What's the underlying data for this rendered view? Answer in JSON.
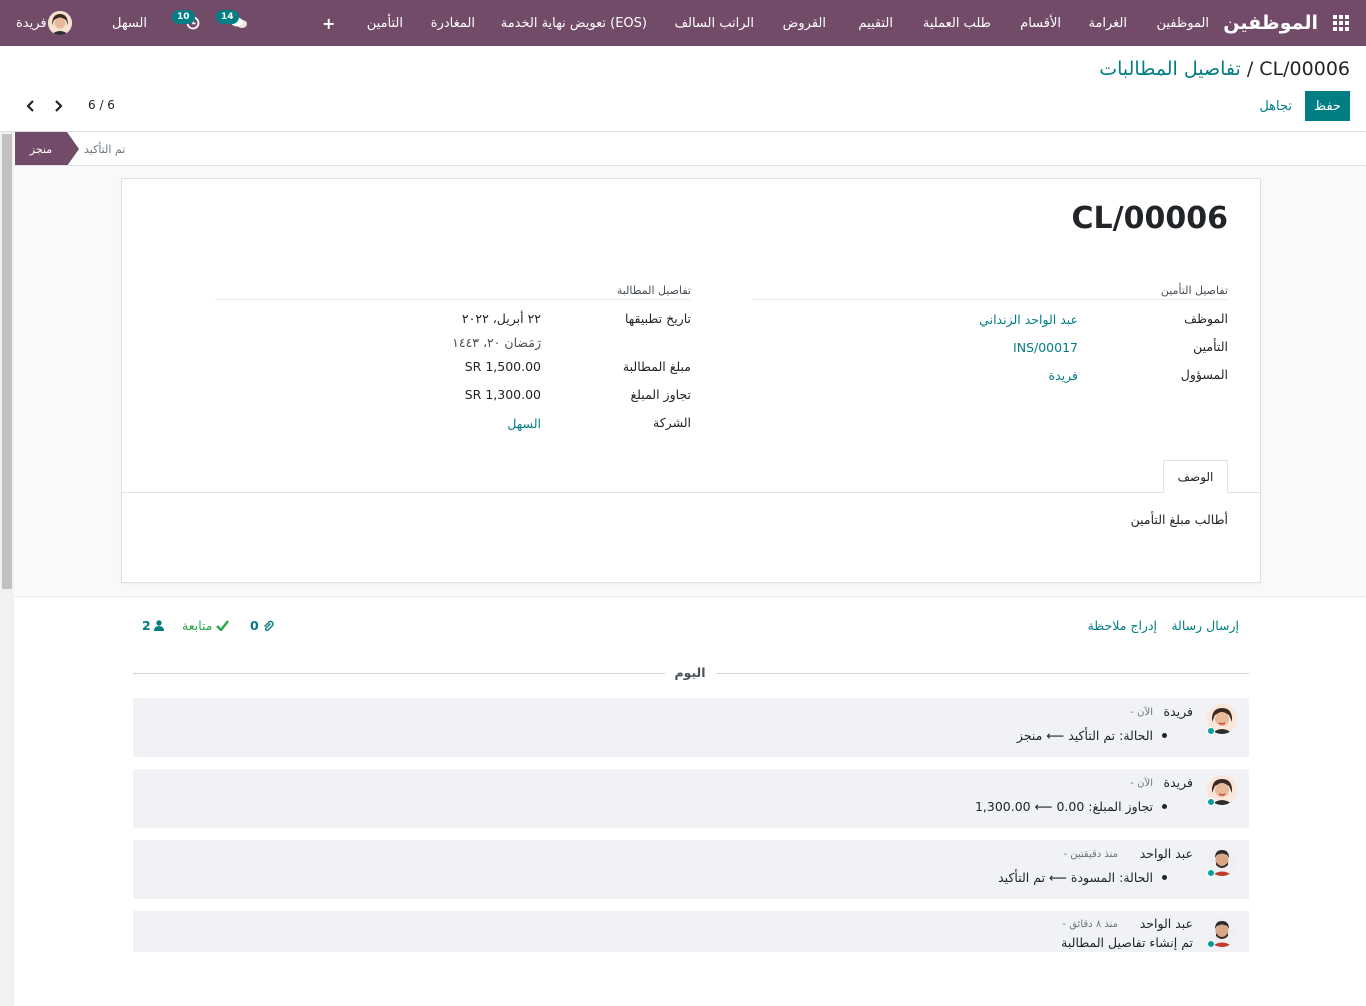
{
  "navbar": {
    "brand": "الموظفين",
    "menu": [
      {
        "label": "الموظفين"
      },
      {
        "label": "الغرامة"
      },
      {
        "label": "الأقسام"
      },
      {
        "label": "طلب العملية"
      },
      {
        "label": "التقييم"
      },
      {
        "label": "القروض"
      },
      {
        "label": "الراتب السالف"
      },
      {
        "label": "تعويض نهاية الخدمة (EOS)"
      },
      {
        "label": "المغادرة"
      },
      {
        "label": "التأمين"
      }
    ],
    "company": "السهل",
    "user": "فريدة",
    "messages_count": "14",
    "activities_count": "10",
    "colors": {
      "primary": "#714b67",
      "accent": "#017e84"
    }
  },
  "control_panel": {
    "breadcrumb": "تفاصيل المطالبات",
    "separator": " / ",
    "current": "CL/00006",
    "save_label": "حفظ",
    "discard_label": "تجاهل",
    "pager": "6 / 6"
  },
  "statusbar": {
    "stages": [
      {
        "label": "منجز",
        "active": true
      },
      {
        "label": "تم التأكيد",
        "active": false
      }
    ]
  },
  "form": {
    "name": "CL/00006",
    "insurance_group": {
      "title": "تفاصيل التأمين",
      "fields": [
        {
          "label": "الموظف",
          "value": "عبد الواحد الزنداني"
        },
        {
          "label": "التأمين",
          "value": "INS/00017"
        },
        {
          "label": "المسؤول",
          "value": "فريدة"
        }
      ]
    },
    "claim_group": {
      "title": "تفاصيل المطالبة",
      "fields": [
        {
          "label": "تاريخ تطبيقها",
          "value": "٢٢ أبريل، ٢٠٢٢",
          "value2": "رَمَضان ٢٠، ١٤٤٣"
        },
        {
          "label": "مبلغ المطالبة",
          "value": "SR 1,500.00"
        },
        {
          "label": "تجاوز المبلغ",
          "value": "SR 1,300.00"
        },
        {
          "label": "الشركة",
          "value": "السهل"
        }
      ]
    },
    "tab_label": "الوصف",
    "description": "أطالب مبلغ التأمين"
  },
  "chatter": {
    "send_message": "إرسال رسالة",
    "log_note": "إدراج ملاحظة",
    "attachments": "0",
    "follow_label": "متابعة",
    "followers": "2",
    "today_label": "اليوم",
    "messages": [
      {
        "author": "فريدة",
        "time": "- الآن",
        "body": "الحالة: تم التأكيد ⟵ منجز"
      },
      {
        "author": "فريدة",
        "time": "- الآن",
        "body": "تجاوز المبلغ: 0.00 ⟵ 1,300.00"
      },
      {
        "author": "عبد الواحد",
        "time": "- منذ دقيقتين",
        "body": "الحالة: المسودة ⟵ تم التأكيد"
      },
      {
        "author": "عبد الواحد",
        "time": "- منذ ٨ دقائق",
        "body": "تم إنشاء تفاصيل المطالبة"
      }
    ]
  }
}
